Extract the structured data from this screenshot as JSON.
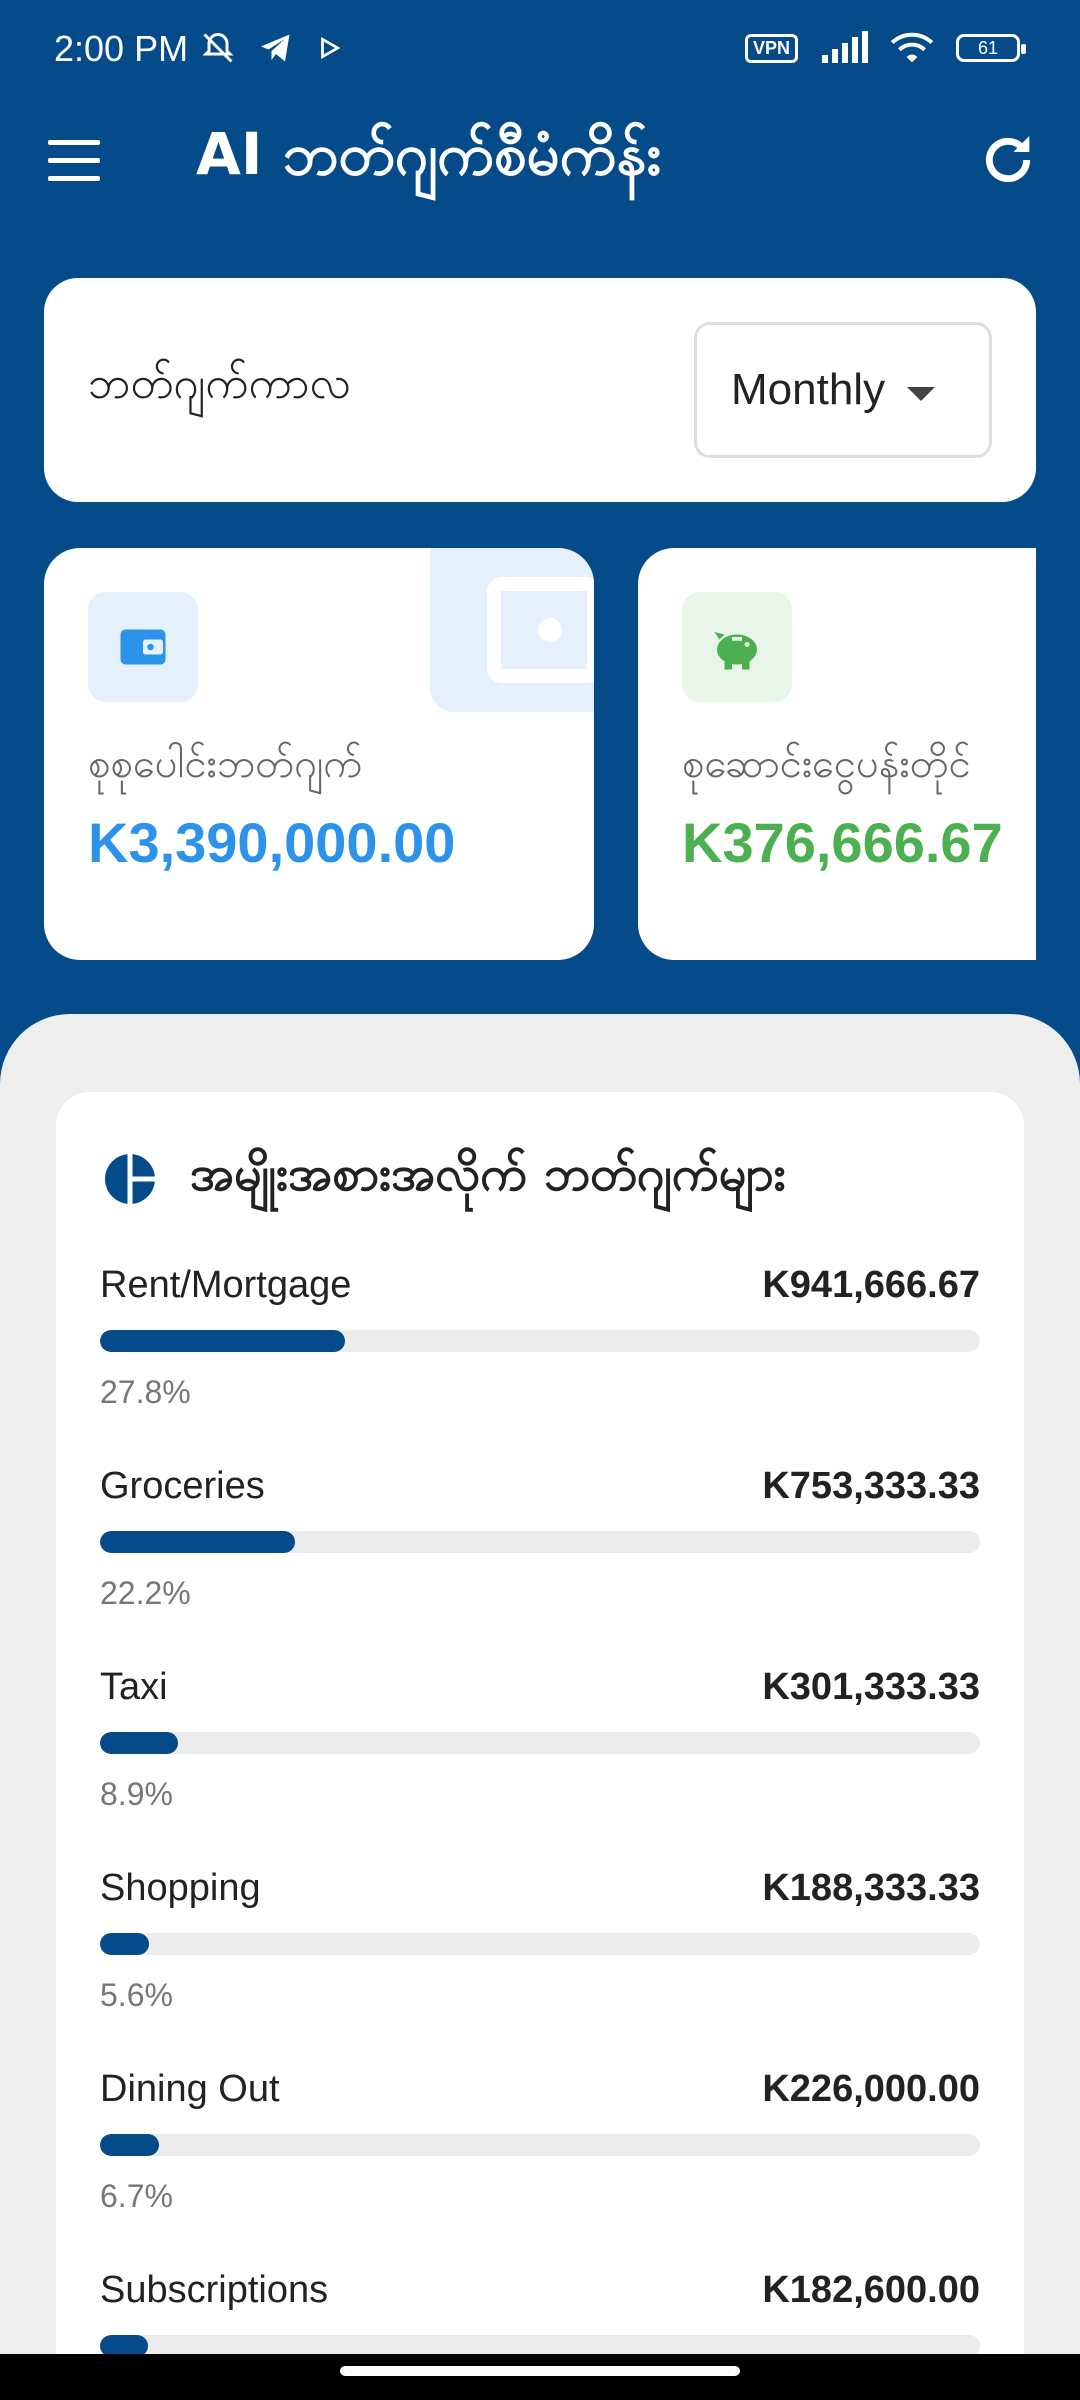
{
  "status_bar": {
    "time": "2:00 PM",
    "vpn": "VPN",
    "battery": "61"
  },
  "app_bar": {
    "title": "AI ဘတ်ဂျက်စီမံကိန်း",
    "menu_icon": "menu-icon",
    "refresh_icon": "refresh-icon"
  },
  "period": {
    "label": "ဘတ်ဂျက်ကာလ",
    "selected": "Monthly"
  },
  "stats": [
    {
      "label": "စုစုပေါင်းဘတ်ဂျက်",
      "value": "K3,390,000.00",
      "color": "#2d93ea",
      "icon": "wallet-icon"
    },
    {
      "label": "စုဆောင်းငွေပန်းတိုင်",
      "value": "K376,666.67",
      "color": "#4caf50",
      "icon": "piggy-bank-icon"
    }
  ],
  "breakdown": {
    "title": "အမျိုးအစားအလိုက် ဘတ်ဂျက်များ",
    "icon": "pie-chart-icon",
    "categories": [
      {
        "name": "Rent/Mortgage",
        "amount": "K941,666.67",
        "percent": "27.8%",
        "fraction": 0.278
      },
      {
        "name": "Groceries",
        "amount": "K753,333.33",
        "percent": "22.2%",
        "fraction": 0.222
      },
      {
        "name": "Taxi",
        "amount": "K301,333.33",
        "percent": "8.9%",
        "fraction": 0.089
      },
      {
        "name": "Shopping",
        "amount": "K188,333.33",
        "percent": "5.6%",
        "fraction": 0.056
      },
      {
        "name": "Dining Out",
        "amount": "K226,000.00",
        "percent": "6.7%",
        "fraction": 0.067
      },
      {
        "name": "Subscriptions",
        "amount": "K182,600.00",
        "percent": "",
        "fraction": 0.054
      }
    ]
  },
  "colors": {
    "primary": "#054a89",
    "blue_accent": "#2d93ea",
    "green_accent": "#4caf50"
  }
}
